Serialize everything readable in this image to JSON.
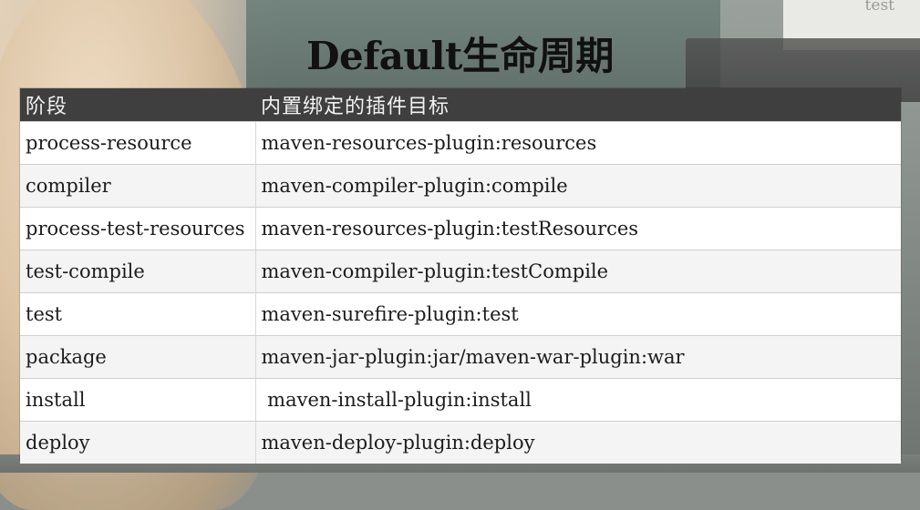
{
  "background": {
    "corner_text": "test"
  },
  "title": "Default生命周期",
  "table": {
    "headers": [
      "阶段",
      "内置绑定的插件目标"
    ],
    "rows": [
      [
        "process-resource",
        "maven-resources-plugin:resources"
      ],
      [
        "compiler",
        "maven-compiler-plugin:compile"
      ],
      [
        "process-test-resources",
        "maven-resources-plugin:testResources"
      ],
      [
        "test-compile",
        "maven-compiler-plugin:testCompile"
      ],
      [
        "test",
        "maven-surefire-plugin:test"
      ],
      [
        "package",
        "maven-jar-plugin:jar/maven-war-plugin:war"
      ],
      [
        "install",
        " maven-install-plugin:install"
      ],
      [
        "deploy",
        "maven-deploy-plugin:deploy"
      ]
    ]
  },
  "colors": {
    "header_bg": "#3f3f3f",
    "header_text": "#f2f2f2",
    "row_odd": "#ffffff",
    "row_even": "#f4f4f4"
  }
}
